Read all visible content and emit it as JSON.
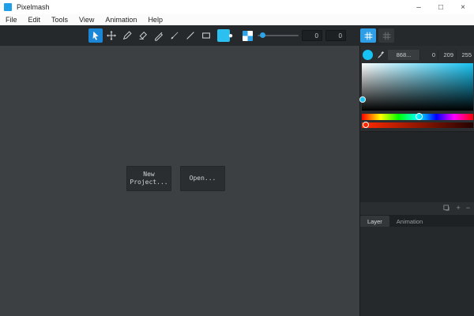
{
  "window": {
    "title": "Pixelmash",
    "minimize": "–",
    "maximize": "□",
    "close": "×"
  },
  "menubar": {
    "items": [
      "File",
      "Edit",
      "Tools",
      "View",
      "Animation",
      "Help"
    ]
  },
  "toolbar": {
    "x_value": "0",
    "y_value": "0"
  },
  "canvas": {
    "new_project_line1": "New",
    "new_project_line2": "Project...",
    "open_label": "Open..."
  },
  "color_panel": {
    "hex": "868...",
    "r": "0",
    "g": "209",
    "b": "255"
  },
  "panel_icons": {
    "plus": "+",
    "minus": "−"
  },
  "tabs": {
    "layer": "Layer",
    "animation": "Animation"
  },
  "colors": {
    "accent": "#2e9fe6",
    "current_color": "#17c3f2",
    "tool_swatch": "#2bc0f0",
    "app_icon": "#1e9fe8"
  }
}
